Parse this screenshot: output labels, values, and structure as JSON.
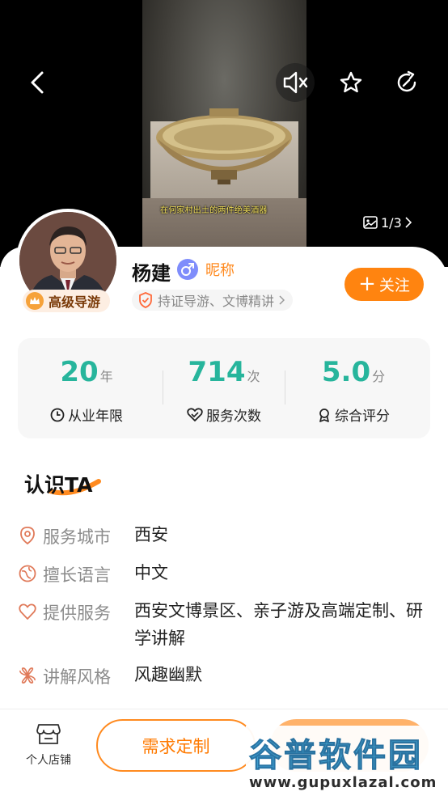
{
  "hero": {
    "caption": "在何家村出土的两件绝美酒器",
    "pager": "1/3"
  },
  "icons": {
    "back": "back-arrow-icon",
    "mute": "mute-icon",
    "favorite": "star-icon",
    "share": "share-icon"
  },
  "profile": {
    "name": "杨建",
    "gender": "male",
    "nickname_label": "昵称",
    "level": "高级导游",
    "certification": "持证导游、文博精讲",
    "follow_label": "关注"
  },
  "stats": [
    {
      "value": "20",
      "unit": "年",
      "label": "从业年限",
      "icon": "clock-icon"
    },
    {
      "value": "714",
      "unit": "次",
      "label": "服务次数",
      "icon": "handshake-heart-icon"
    },
    {
      "value": "5.0",
      "unit": "分",
      "label": "综合评分",
      "icon": "award-icon"
    }
  ],
  "about": {
    "title": "认识TA",
    "rows": [
      {
        "key": "服务城市",
        "value": "西安",
        "icon": "location-pin-icon"
      },
      {
        "key": "擅长语言",
        "value": "中文",
        "icon": "language-globe-icon"
      },
      {
        "key": "提供服务",
        "value": "西安文博景区、亲子游及高端定制、研学讲解",
        "icon": "heart-icon"
      },
      {
        "key": "讲解风格",
        "value": "风趣幽默",
        "icon": "flower-icon"
      }
    ]
  },
  "bottom": {
    "shop_label": "个人店铺",
    "request_label": "需求定制"
  },
  "watermark": {
    "cn": "谷普软件园",
    "en": "www.gupuxlazal.com"
  },
  "colors": {
    "accent": "#ff8410",
    "stat_number": "#27b59c",
    "gender": "#7f8dfb"
  }
}
